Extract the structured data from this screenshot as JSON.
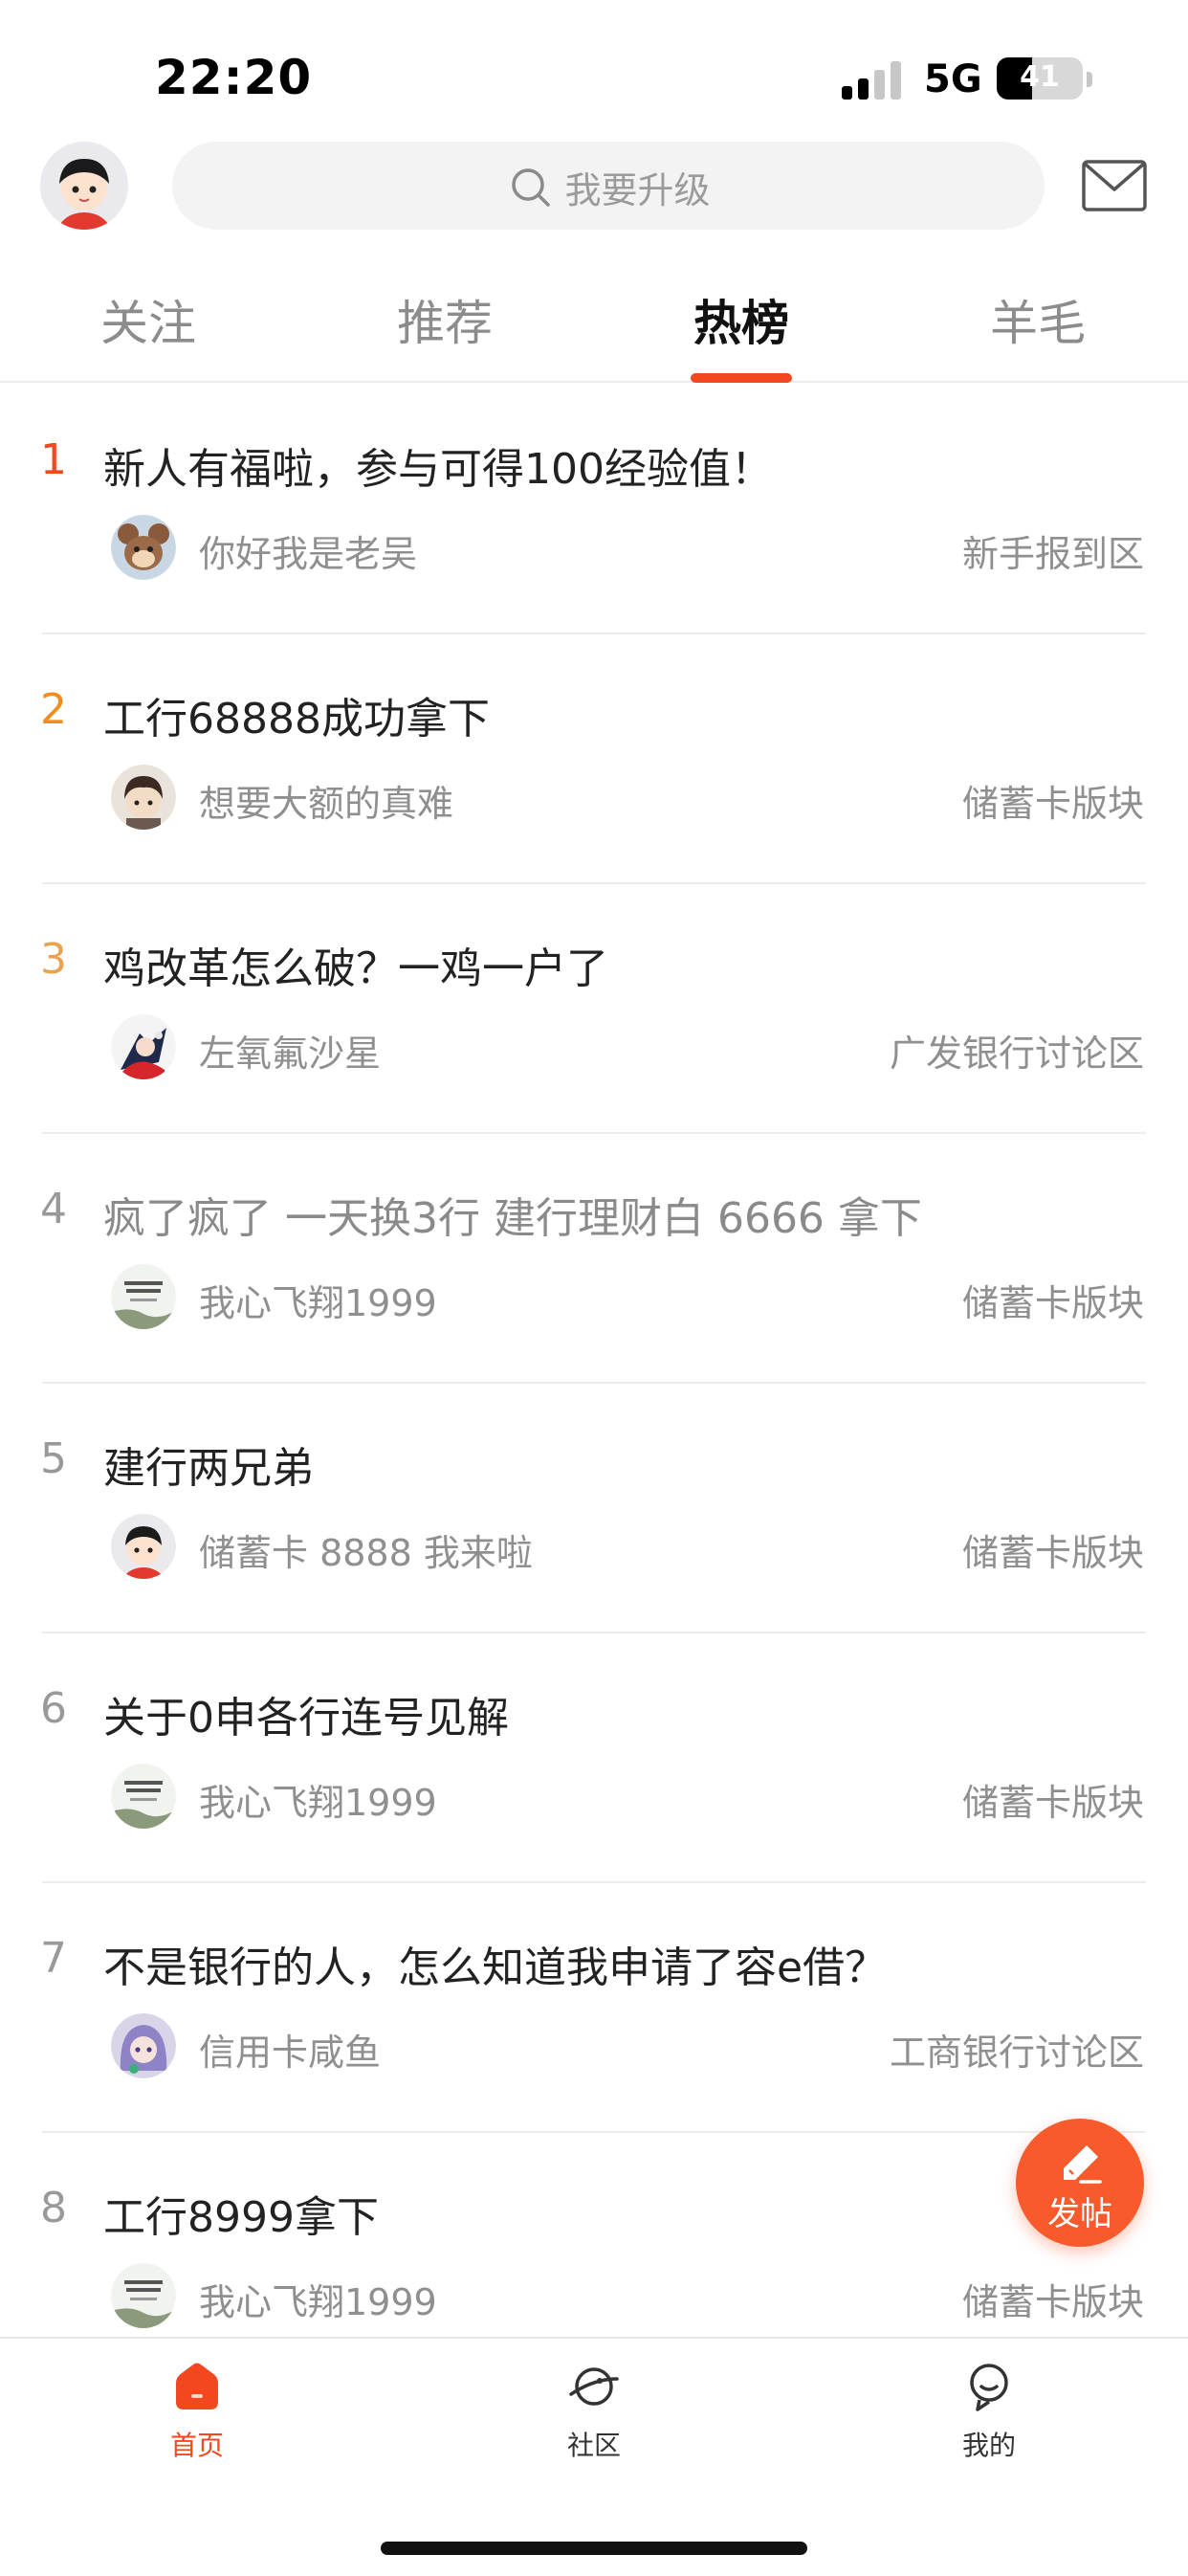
{
  "status_bar": {
    "time": "22:20",
    "network": "5G",
    "battery": "41",
    "battery_level": 0.41
  },
  "header": {
    "search_placeholder": "我要升级"
  },
  "tabs": [
    {
      "label": "关注",
      "active": false
    },
    {
      "label": "推荐",
      "active": false
    },
    {
      "label": "热榜",
      "active": true
    },
    {
      "label": "羊毛",
      "active": false
    }
  ],
  "hot_list": [
    {
      "rank": "1",
      "title": "新人有福啦，参与可得100经验值！",
      "author": "你好我是老吴",
      "board": "新手报到区"
    },
    {
      "rank": "2",
      "title": "工行68888成功拿下",
      "author": "想要大额的真难",
      "board": "储蓄卡版块"
    },
    {
      "rank": "3",
      "title": "鸡改革怎么破？一鸡一户了",
      "author": "左氧氟沙星",
      "board": "广发银行讨论区"
    },
    {
      "rank": "4",
      "title": "疯了疯了 一天换3行  建行理财白 6666 拿下",
      "author": "我心飞翔1999",
      "board": "储蓄卡版块"
    },
    {
      "rank": "5",
      "title": "建行两兄弟",
      "author": "储蓄卡 8888 我来啦",
      "board": "储蓄卡版块"
    },
    {
      "rank": "6",
      "title": "关于0申各行连号见解",
      "author": "我心飞翔1999",
      "board": "储蓄卡版块"
    },
    {
      "rank": "7",
      "title": "不是银行的人，怎么知道我申请了容e借？",
      "author": "信用卡咸鱼",
      "board": "工商银行讨论区"
    },
    {
      "rank": "8",
      "title": "工行8999拿下",
      "author": "我心飞翔1999",
      "board": "储蓄卡版块"
    }
  ],
  "fab": {
    "label": "发帖"
  },
  "bottom_nav": [
    {
      "label": "首页",
      "icon": "home-icon",
      "active": true
    },
    {
      "label": "社区",
      "icon": "planet-icon",
      "active": false
    },
    {
      "label": "我的",
      "icon": "profile-icon",
      "active": false
    }
  ],
  "colors": {
    "accent": "#f3481f",
    "rank2": "#f58b1f",
    "rank3": "#eaa24f",
    "fab": "#f85a2b"
  }
}
